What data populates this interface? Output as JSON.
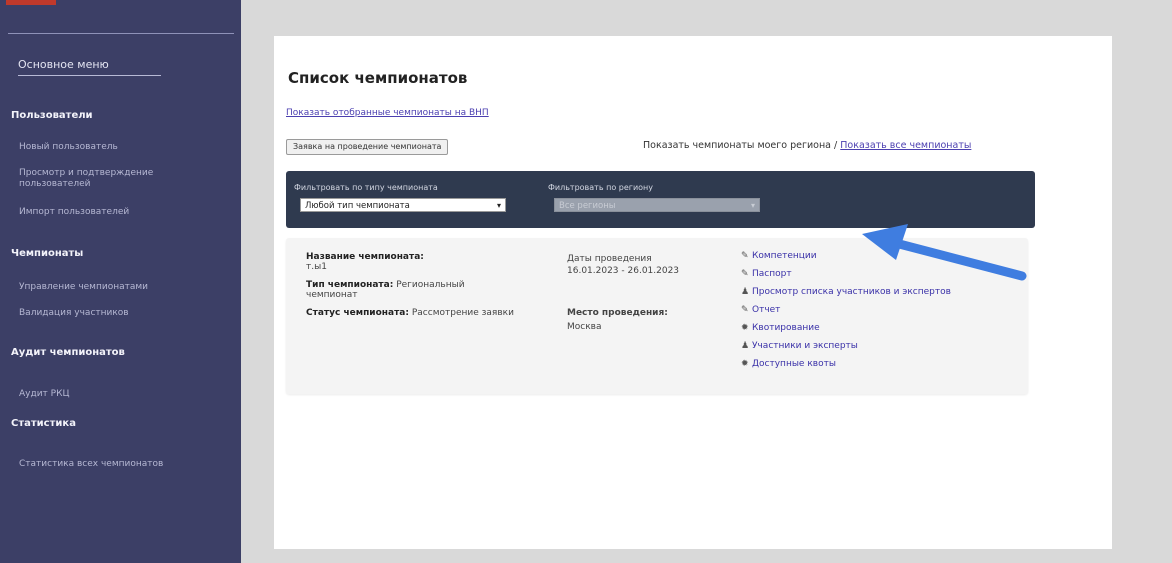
{
  "sidebar": {
    "main_menu": "Основное меню",
    "sections": [
      {
        "heading": "Пользователи",
        "items": [
          "Новый пользователь",
          "Просмотр и подтверждение пользователей",
          "Импорт пользователей"
        ]
      },
      {
        "heading": "Чемпионаты",
        "items": [
          "Управление чемпионатами",
          "Валидация участников"
        ]
      },
      {
        "heading": "Аудит чемпионатов",
        "items": [
          "Аудит РКЦ"
        ]
      },
      {
        "heading": "Статистика",
        "items": [
          "Статистика всех чемпионатов"
        ]
      }
    ]
  },
  "page": {
    "title": "Список чемпионатов",
    "favorites_link": "Показать отобранные чемпионаты на ВНП",
    "apply_button": "Заявка на проведение чемпионата",
    "region_text": "Показать чемпионаты моего региона",
    "region_separator": "/",
    "all_link": "Показать все чемпионаты"
  },
  "filters": {
    "type_label": "Фильтровать по типу чемпионата",
    "type_value": "Любой тип чемпионата",
    "region_label": "Фильтровать по региону",
    "region_value": "Все регионы"
  },
  "championship": {
    "name_label": "Название чемпионата:",
    "name_value": "т.ы1",
    "type_label": "Тип чемпионата:",
    "type_value": "Региональный чемпионат",
    "status_label": "Статус чемпионата:",
    "status_value": "Рассмотрение заявки",
    "dates_label": "Даты проведения",
    "dates_value": "16.01.2023 - 26.01.2023",
    "place_label": "Место проведения:",
    "place_value": "Москва",
    "actions": [
      {
        "icon": "wrench-icon",
        "label": "Компетенции"
      },
      {
        "icon": "wrench-icon",
        "label": "Паспорт"
      },
      {
        "icon": "person-icon",
        "label": "Просмотр списка участников и экспертов"
      },
      {
        "icon": "wrench-icon",
        "label": "Отчет"
      },
      {
        "icon": "gear-icon",
        "label": "Квотирование"
      },
      {
        "icon": "person-icon",
        "label": "Участники и эксперты"
      },
      {
        "icon": "gear-icon",
        "label": "Доступные квоты"
      }
    ]
  },
  "colors": {
    "sidebar": "#3c3f66",
    "filter_bar": "#2f3a4f",
    "arrow": "#3f7de0",
    "link": "#4b3fb0"
  }
}
